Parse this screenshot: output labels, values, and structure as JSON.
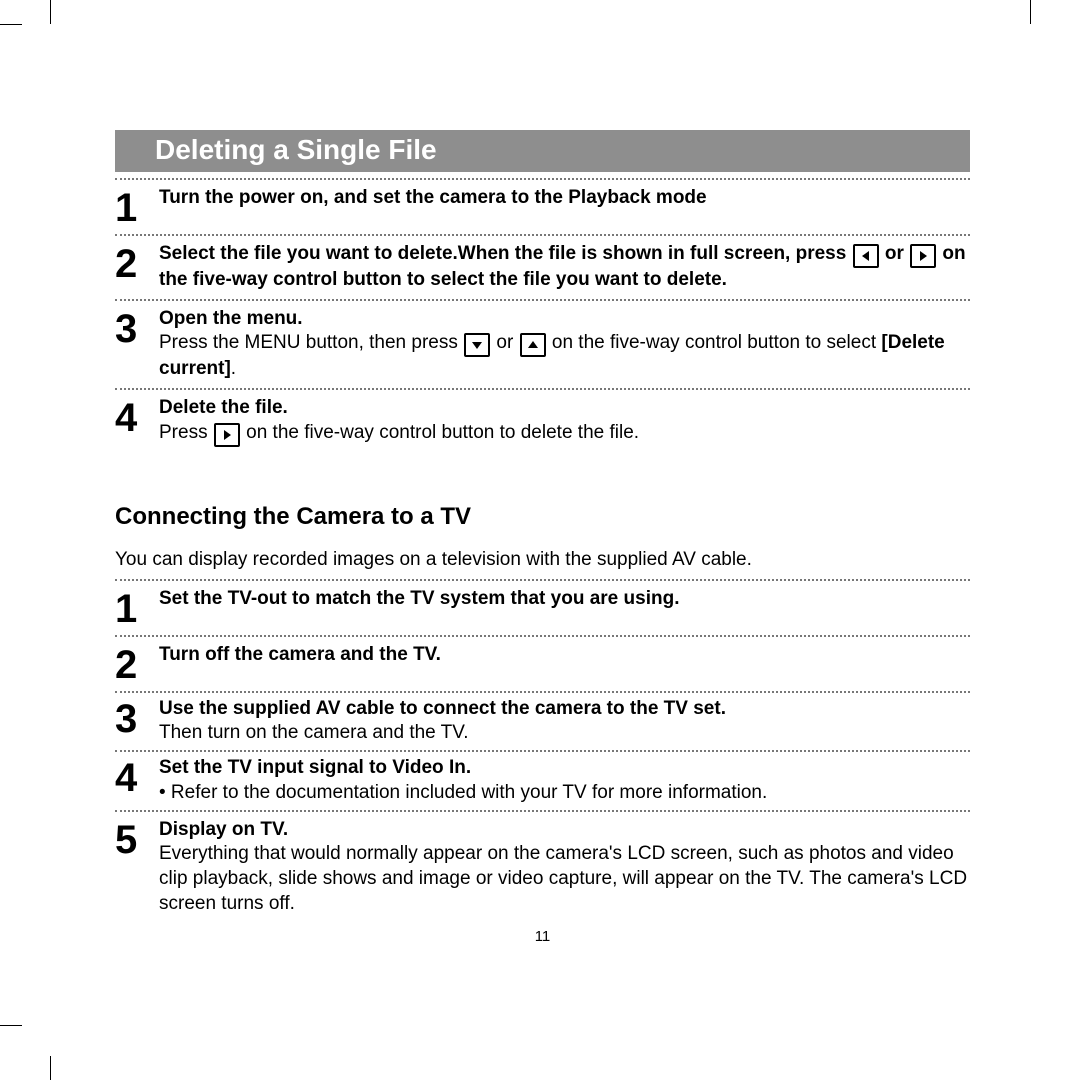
{
  "section1": {
    "title": "Deleting a Single File",
    "steps": [
      {
        "num": "1",
        "bold": "Turn the power on, and set the camera to the Playback mode"
      },
      {
        "num": "2",
        "bold_part1": "Select the file you want to delete.When the file is shown in full screen, press ",
        "bold_or": " or ",
        "bold_part2": " on the five-way control button to select the file you want to delete."
      },
      {
        "num": "3",
        "bold": "Open the menu.",
        "text_part1": "Press the MENU button, then press ",
        "text_or": " or ",
        "text_part2": " on the five-way control button to select ",
        "text_strong": "[Delete current]",
        "text_end": "."
      },
      {
        "num": "4",
        "bold": "Delete the file.",
        "text_part1": "Press ",
        "text_part2": " on the five-way control button to delete the file."
      }
    ]
  },
  "section2": {
    "heading": "Connecting the Camera to a TV",
    "intro": "You can display recorded images on a television with the supplied AV cable.",
    "steps": [
      {
        "num": "1",
        "bold": "Set the TV-out to match the TV system that you are using."
      },
      {
        "num": "2",
        "bold": "Turn off the camera and the TV."
      },
      {
        "num": "3",
        "bold": "Use the supplied AV cable to connect the camera to the TV set.",
        "text": "Then turn on the camera and the TV."
      },
      {
        "num": "4",
        "bold": "Set the TV input signal to Video In.",
        "bullet": "• Refer to the documentation included with your TV for more information."
      },
      {
        "num": "5",
        "bold": "Display on TV.",
        "text": "Everything that would normally appear on the camera's LCD screen, such as photos and video clip playback, slide shows and image or video capture, will appear on the TV. The camera's LCD screen turns off."
      }
    ]
  },
  "page_number": "11"
}
